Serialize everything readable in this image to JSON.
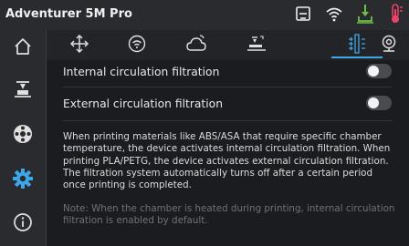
{
  "header": {
    "title": "Adventurer 5M Pro"
  },
  "status_icons": [
    "printer-status-icon",
    "wifi-icon",
    "print-job-icon",
    "temperature-alert-icon"
  ],
  "sidebar": {
    "items": [
      "home-icon",
      "print-control-icon",
      "filament-icon",
      "settings-icon",
      "info-icon"
    ],
    "active_index": 3
  },
  "tabs": {
    "items": [
      "move-axes-icon",
      "network-icon",
      "cloud-icon",
      "calibration-icon",
      "air-filtration-icon",
      "camera-icon"
    ],
    "active_index": 4
  },
  "settings": {
    "internal_label": "Internal circulation filtration",
    "internal_enabled": false,
    "external_label": "External circulation filtration",
    "external_enabled": false
  },
  "description": "When printing materials like ABS/ASA that require specific chamber temperature, the device activates internal circulation filtration. When printing PLA/PETG, the device activates external circulation filtration. The filtration system automatically turns off after a certain period once printing is completed.",
  "note": "Note: When the chamber is heated during printing, internal circulation filtration is enabled by default.",
  "colors": {
    "accent": "#3da8e8",
    "alert_red": "#e8436a",
    "job_green": "#6cc04a",
    "background": "#1b1c1f",
    "panel": "#2a2b2f"
  }
}
